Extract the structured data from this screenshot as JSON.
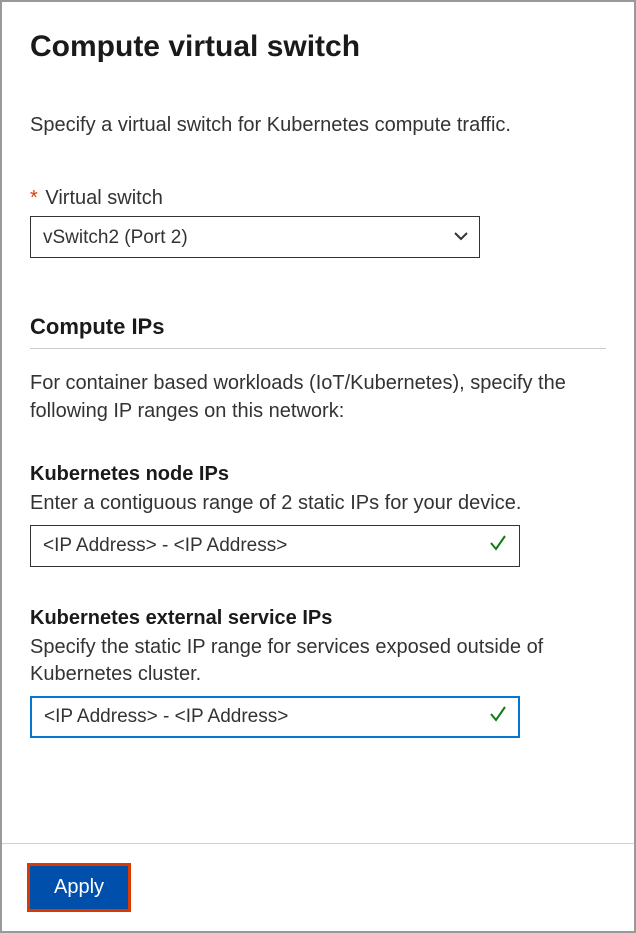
{
  "page": {
    "title": "Compute virtual switch",
    "description": "Specify a virtual switch for Kubernetes compute traffic."
  },
  "virtual_switch": {
    "label": "Virtual switch",
    "value": "vSwitch2 (Port 2)"
  },
  "compute_ips": {
    "section_title": "Compute IPs",
    "section_description": "For container based workloads (IoT/Kubernetes), specify the following IP ranges on this network:",
    "node_ips": {
      "title": "Kubernetes node IPs",
      "description": "Enter a contiguous range of 2 static IPs for your device.",
      "value": "<IP Address> - <IP Address>"
    },
    "service_ips": {
      "title": "Kubernetes external service IPs",
      "description": "Specify the static IP range for services exposed outside of Kubernetes cluster.",
      "value": "<IP Address> - <IP Address>"
    }
  },
  "footer": {
    "apply_label": "Apply"
  }
}
